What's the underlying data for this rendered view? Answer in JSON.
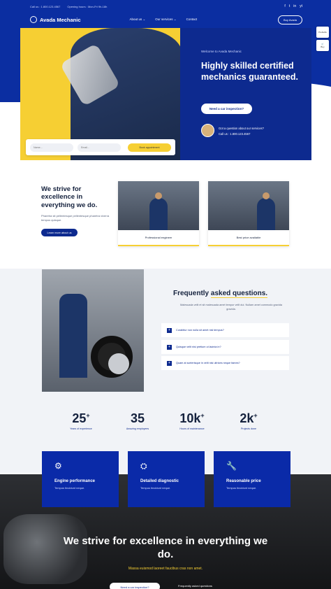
{
  "topbar": {
    "phone": "Call us : 1.800.123.4567",
    "hours": "Opening hours : Mon-Fri 9h-18h",
    "social": [
      "f",
      "t",
      "in",
      "yt"
    ]
  },
  "nav": {
    "brand": "Avada Mechanic",
    "items": [
      "About us ⌄",
      "Our services ⌄",
      "Contact"
    ],
    "book": "Buy Avada"
  },
  "widgets": [
    "Prebuilts",
    "Buy"
  ],
  "hero": {
    "kicker": "Welcome to Avada Mechanic",
    "title": "Highly skilled certified mechanics guaranteed.",
    "cta": "Need a car inspection?",
    "question": "Got a question about our services?",
    "call": "Call us : 1.800.123.4567",
    "form": {
      "name_ph": "Name...",
      "email_ph": "Email...",
      "button": "Book appointment"
    }
  },
  "strive": {
    "title": "We strive for excellence in everything we do.",
    "text": "Pharetra sit pellentesque pellentesque pharetra viverra tempus quisque.",
    "button": "Learn more about us",
    "cards": [
      "Professional engineer",
      "Best price available"
    ]
  },
  "faq": {
    "title_a": "Frequently ",
    "title_b": "asked questions.",
    "desc": "Malesuada velit et sit malesuada amet tempor velit dui. Nullam amet commodo gravida gravida.",
    "items": [
      "Curabitur non nulla sit amet nisl tempus?",
      "Quisque velit nisi pretium ut lacinia in?",
      "Quam at scelerisque in velit nisi ultrices neque fames?"
    ]
  },
  "stats": [
    {
      "n": "25",
      "suf": "+",
      "l": "Years of experience"
    },
    {
      "n": "35",
      "suf": "",
      "l": "Amazing employees"
    },
    {
      "n": "10k",
      "suf": "+",
      "l": "Hours of maintenance"
    },
    {
      "n": "2k",
      "suf": "+",
      "l": "Projects done"
    }
  ],
  "services": [
    {
      "icon": "⚙",
      "t": "Engine performance",
      "s": "Tempus tincidunt neque."
    },
    {
      "icon": "⛭",
      "t": "Detailed diagnostic",
      "s": "Tempus tincidunt neque."
    },
    {
      "icon": "🔧",
      "t": "Reasonable price",
      "s": "Tempus tincidunt neque."
    }
  ],
  "bottom": {
    "title": "We strive for excellence in everything we do.",
    "sub": "Massa euismod laoreet faucibus cras non amet.",
    "cta": "Need a car inspection?",
    "call": "Frequently asked questions"
  },
  "colors": {
    "brand": "#0d2a8f",
    "accent": "#f6cf33"
  }
}
